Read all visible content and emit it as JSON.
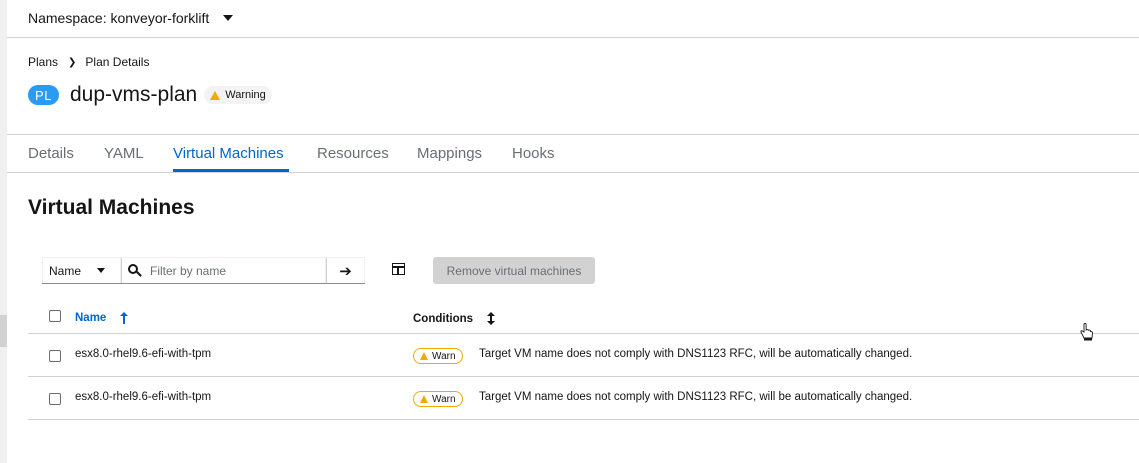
{
  "namespace": {
    "label": "Namespace: konveyor-forklift"
  },
  "breadcrumb": {
    "parent": "Plans",
    "current": "Plan Details"
  },
  "plan": {
    "badge": "PL",
    "name": "dup-vms-plan",
    "status": "Warning"
  },
  "tabs": [
    {
      "label": "Details",
      "active": false
    },
    {
      "label": "YAML",
      "active": false
    },
    {
      "label": "Virtual Machines",
      "active": true
    },
    {
      "label": "Resources",
      "active": false
    },
    {
      "label": "Mappings",
      "active": false
    },
    {
      "label": "Hooks",
      "active": false
    }
  ],
  "section": {
    "title": "Virtual Machines"
  },
  "toolbar": {
    "filter_attribute": "Name",
    "filter_placeholder": "Filter by name",
    "remove_label": "Remove virtual machines"
  },
  "table": {
    "columns": {
      "name": "Name",
      "conditions": "Conditions"
    },
    "rows": [
      {
        "name": "esx8.0-rhel9.6-efi-with-tpm",
        "condition": "Warn",
        "message": "Target VM name does not comply with DNS1123 RFC, will be automatically changed."
      },
      {
        "name": "esx8.0-rhel9.6-efi-with-tpm",
        "condition": "Warn",
        "message": "Target VM name does not comply with DNS1123 RFC, will be automatically changed."
      }
    ]
  },
  "colors": {
    "accent": "#0066cc",
    "badge": "#2b9af3",
    "warning": "#f0ab00"
  }
}
